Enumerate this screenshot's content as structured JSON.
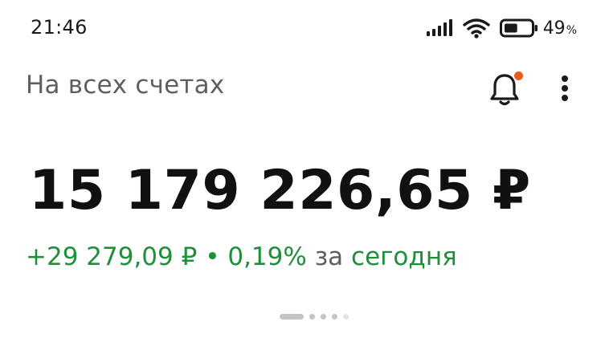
{
  "status_bar": {
    "time": "21:46",
    "battery_percent": "49",
    "battery_percent_sign": "%",
    "battery_level": 0.49,
    "icons": [
      "signal-icon",
      "wifi-icon",
      "battery-icon"
    ]
  },
  "header": {
    "title": "На всех счетах",
    "has_notification": true,
    "notification_dot_color": "#e85d1c",
    "icons": [
      "bell-icon",
      "more-vertical-icon"
    ]
  },
  "balance": {
    "amount": "15 179 226,65 ₽",
    "change_amount": "+29 279,09 ₽",
    "separator": "•",
    "change_percent": "0,19%",
    "period_prefix": "за",
    "period": "сегодня",
    "positive_color": "#1f8f3a"
  },
  "pager": {
    "pages": 5,
    "current_page": 1
  }
}
